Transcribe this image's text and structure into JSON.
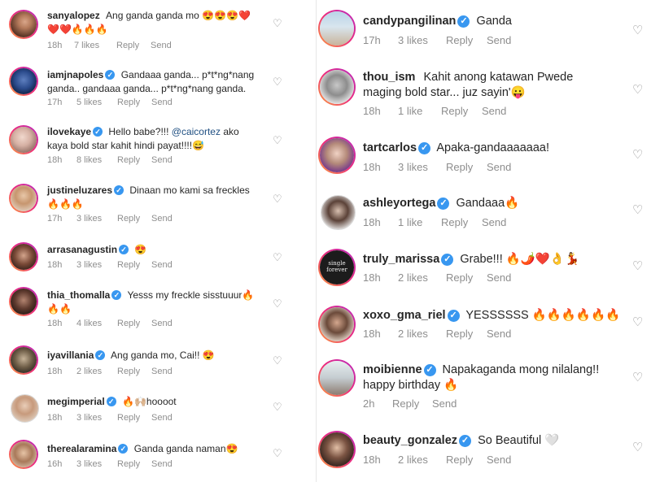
{
  "left_comments": [
    {
      "user": "sanyalopez",
      "verified": false,
      "text": "Ang ganda ganda mo 😍😍😍❤️",
      "text2": "❤️❤️🔥🔥🔥",
      "time": "18h",
      "likes": "7 likes",
      "reply": "Reply",
      "send": "Send"
    },
    {
      "user": "iamjnapoles",
      "verified": true,
      "text": "Gandaaa ganda... p*t*ng*nang",
      "text2": "ganda.. gandaaa  ganda... p*t*ng*nang ganda.",
      "time": "17h",
      "likes": "5 likes",
      "reply": "Reply",
      "send": "Send"
    },
    {
      "user": "ilovekaye",
      "verified": true,
      "text": "Hello babe?!!! ",
      "mention": "@caicortez",
      "text_after": " ako",
      "text2": "kaya bold star kahit hindi payat!!!!😅",
      "time": "18h",
      "likes": "8 likes",
      "reply": "Reply",
      "send": "Send"
    },
    {
      "user": "justineluzares",
      "verified": true,
      "text": "Dinaan mo kami sa freckles",
      "text2": "🔥🔥🔥",
      "time": "17h",
      "likes": "3 likes",
      "reply": "Reply",
      "send": "Send"
    },
    {
      "user": "arrasanagustin",
      "verified": true,
      "text": "😍",
      "time": "18h",
      "likes": "3 likes",
      "reply": "Reply",
      "send": "Send"
    },
    {
      "user": "thia_thomalla",
      "verified": true,
      "text": "Yesss my freckle sisstuuur🔥",
      "text2": "🔥🔥",
      "time": "18h",
      "likes": "4 likes",
      "reply": "Reply",
      "send": "Send"
    },
    {
      "user": "iyavillania",
      "verified": true,
      "text": "Ang ganda mo, Cai!! 😍",
      "time": "18h",
      "likes": "2 likes",
      "reply": "Reply",
      "send": "Send"
    },
    {
      "user": "megimperial",
      "verified": true,
      "text": "🔥🙌🏼hoooot",
      "time": "18h",
      "likes": "3 likes",
      "reply": "Reply",
      "send": "Send"
    },
    {
      "user": "therealaramina",
      "verified": true,
      "text": "Ganda ganda naman😍",
      "time": "16h",
      "likes": "3 likes",
      "reply": "Reply",
      "send": "Send"
    }
  ],
  "right_comments": [
    {
      "user": "candypangilinan",
      "verified": true,
      "text": "Ganda",
      "time": "17h",
      "likes": "3 likes",
      "reply": "Reply",
      "send": "Send"
    },
    {
      "user": "thou_ism",
      "verified": false,
      "text": "Kahit anong katawan Pwede",
      "text2": "maging bold star... juz sayin'😛",
      "time": "18h",
      "likes": "1 like",
      "reply": "Reply",
      "send": "Send"
    },
    {
      "user": "tartcarlos",
      "verified": true,
      "text": "Apaka-gandaaaaaaa!",
      "time": "18h",
      "likes": "3 likes",
      "reply": "Reply",
      "send": "Send"
    },
    {
      "user": "ashleyortega",
      "verified": true,
      "text": "Gandaaa🔥",
      "time": "18h",
      "likes": "1 like",
      "reply": "Reply",
      "send": "Send"
    },
    {
      "user": "truly_marissa",
      "verified": true,
      "text": "Grabe!!! 🔥🌶️❤️👌💃",
      "time": "18h",
      "likes": "2 likes",
      "reply": "Reply",
      "send": "Send"
    },
    {
      "user": "xoxo_gma_riel",
      "verified": true,
      "text": "YESSSSSS 🔥🔥🔥🔥🔥🔥",
      "time": "18h",
      "likes": "2 likes",
      "reply": "Reply",
      "send": "Send"
    },
    {
      "user": "moibienne",
      "verified": true,
      "text": "Napakaganda mong nilalang!!",
      "text2": "happy birthday 🔥",
      "time": "2h",
      "likes": "",
      "reply": "Reply",
      "send": "Send"
    },
    {
      "user": "beauty_gonzalez",
      "verified": true,
      "text": "So Beautiful 🤍",
      "time": "18h",
      "likes": "2 likes",
      "reply": "Reply",
      "send": "Send"
    }
  ],
  "avatar_text": {
    "truly_marissa": "single forever"
  },
  "icons": {
    "verified": "verified-badge-icon",
    "like": "heart-outline-icon"
  },
  "colors": {
    "username": "#262626",
    "meta": "#8e8e8e",
    "verified": "#3897f0",
    "mention": "#1f4f82"
  }
}
